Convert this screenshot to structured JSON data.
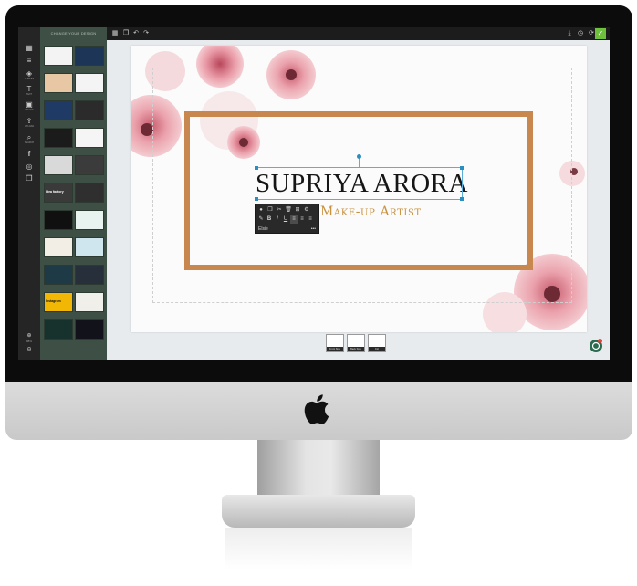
{
  "rail": {
    "items": [
      {
        "icon": "grid-icon",
        "label": ""
      },
      {
        "icon": "layers-icon",
        "label": ""
      },
      {
        "icon": "shapes-icon",
        "label": "SHAPES"
      },
      {
        "icon": "text-icon",
        "label": "TEXT"
      },
      {
        "icon": "image-icon",
        "label": "IMAGES"
      },
      {
        "icon": "upload-icon",
        "label": "UPLOAD"
      },
      {
        "icon": "search-icon",
        "label": "SEARCH"
      },
      {
        "icon": "facebook-icon",
        "label": ""
      },
      {
        "icon": "instagram-icon",
        "label": ""
      },
      {
        "icon": "copy-icon",
        "label": ""
      }
    ],
    "zoom_label": "88%"
  },
  "panel": {
    "header": "CHANGE YOUR DESIGN",
    "thumb_colors": [
      [
        "#f3f3f3",
        "#1d3557"
      ],
      [
        "#e8c7a5",
        "#f4f4f4"
      ],
      [
        "#1f3a64",
        "#2b2b2b"
      ],
      [
        "#1b1b1b",
        "#f5f5f5"
      ],
      [
        "#d9d9d9",
        "#3b3b3b"
      ],
      [
        "#3a3a3a",
        "#2f2f2f"
      ],
      [
        "#101010",
        "#e8f3f0"
      ],
      [
        "#f2eee6",
        "#cfe6ee"
      ],
      [
        "#1e3a46",
        "#27303a"
      ],
      [
        "#f2b705",
        "#f0efe9"
      ],
      [
        "#17312c",
        "#12121a"
      ]
    ],
    "thumb_texts": {
      "idea": "Idea factory",
      "instagram": "Instagram"
    }
  },
  "toolbar": {
    "icons": [
      "grid-icon",
      "copy-icon",
      "undo-icon",
      "redo-icon"
    ],
    "right_icons": [
      "download-icon",
      "history-icon",
      "refresh-icon",
      "close-icon"
    ],
    "close_glyph": "✕",
    "confirm_glyph": "✓"
  },
  "card": {
    "name": "SUPRIYA ARORA",
    "role": "Make-up Artist",
    "frame_color": "#c98750",
    "role_color": "#c9923f"
  },
  "text_toolbar": {
    "row1": [
      "color-icon",
      "copy-icon",
      "cut-icon",
      "delete-icon",
      "grid-icon",
      "settings-icon"
    ],
    "row2": [
      "edit-icon",
      "bold-icon",
      "italic-icon",
      "underline-icon",
      "align-left-icon",
      "align-center-icon",
      "align-right-icon"
    ],
    "font": "Elsie",
    "more": "•••"
  },
  "pages": [
    {
      "label": "Front Side"
    },
    {
      "label": "Back Side"
    },
    {
      "label": "Fol"
    }
  ],
  "chat": {
    "badge": "1"
  }
}
